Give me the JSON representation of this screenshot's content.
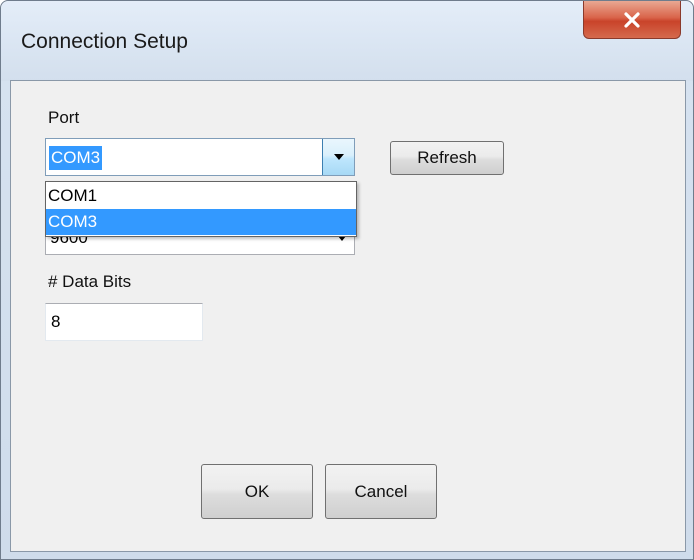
{
  "window": {
    "title": "Connection Setup"
  },
  "port": {
    "label": "Port",
    "selected": "COM3",
    "options": [
      "COM1",
      "COM3"
    ],
    "refresh_label": "Refresh"
  },
  "baud": {
    "partial_value": "9600"
  },
  "data_bits": {
    "label": "# Data Bits",
    "value": "8"
  },
  "buttons": {
    "ok_label": "OK",
    "cancel_label": "Cancel"
  },
  "colors": {
    "selection": "#3399ff",
    "close_button": "#c9432a",
    "dialog_background": "#f0f0f0"
  },
  "icons": {
    "close": "close-icon",
    "dropdown": "chevron-down-icon"
  }
}
